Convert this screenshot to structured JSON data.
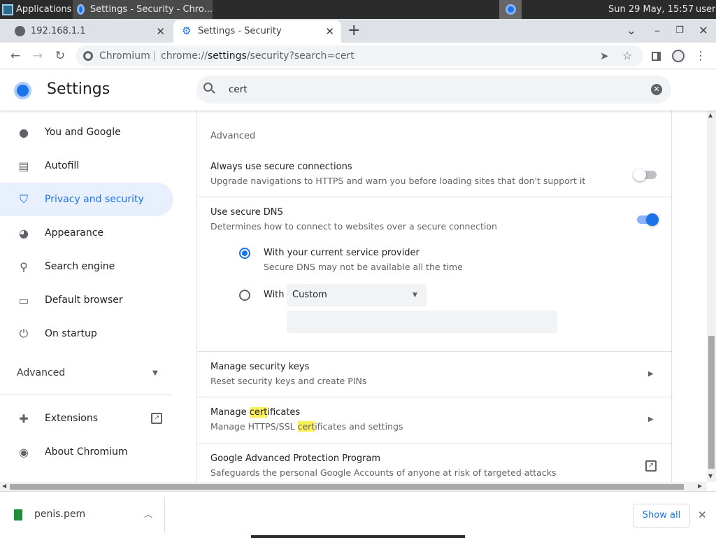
{
  "taskbar": {
    "apps_label": "Applications",
    "window_title": "Settings - Security - Chro...",
    "clock": "Sun 29 May, 15:57",
    "user": "user"
  },
  "tabs": [
    {
      "title": "192.168.1.1",
      "close": "✕"
    },
    {
      "title": "Settings - Security",
      "close": "✕"
    }
  ],
  "new_tab": "+",
  "window_controls": {
    "dropdown": "⌄",
    "minimize": "–",
    "restore": "❐",
    "close": "✕"
  },
  "toolbar": {
    "site_name": "Chromium",
    "url_scheme": "chrome://",
    "url_host": "settings",
    "url_path": "/security?search=cert"
  },
  "settings": {
    "title": "Settings",
    "search_value": "cert"
  },
  "sidebar": {
    "items": [
      {
        "label": "You and Google",
        "icon": "person-icon"
      },
      {
        "label": "Autofill",
        "icon": "clipboard-icon"
      },
      {
        "label": "Privacy and security",
        "icon": "shield-icon"
      },
      {
        "label": "Appearance",
        "icon": "palette-icon"
      },
      {
        "label": "Search engine",
        "icon": "search-icon"
      },
      {
        "label": "Default browser",
        "icon": "browser-icon"
      },
      {
        "label": "On startup",
        "icon": "power-icon"
      }
    ],
    "advanced_label": "Advanced",
    "extensions_label": "Extensions",
    "about_label": "About Chromium"
  },
  "content": {
    "section_heading": "Advanced",
    "always_secure": {
      "title": "Always use secure connections",
      "sub": "Upgrade navigations to HTTPS and warn you before loading sites that don't support it",
      "enabled": false
    },
    "secure_dns": {
      "title": "Use secure DNS",
      "sub": "Determines how to connect to websites over a secure connection",
      "enabled": true,
      "option1_title": "With your current service provider",
      "option1_sub": "Secure DNS may not be available all the time",
      "option2_label": "With",
      "provider_selected": "Custom",
      "custom_input_value": ""
    },
    "security_keys": {
      "title": "Manage security keys",
      "sub": "Reset security keys and create PINs"
    },
    "certificates": {
      "title_pre": "Manage ",
      "title_mark": "cert",
      "title_post": "ificates",
      "sub_pre": "Manage HTTPS/SSL ",
      "sub_mark": "cert",
      "sub_post": "ificates and settings"
    },
    "gapp": {
      "title": "Google Advanced Protection Program",
      "sub": "Safeguards the personal Google Accounts of anyone at risk of targeted attacks"
    }
  },
  "downloads": {
    "file_name": "penis.pem",
    "show_all": "Show all"
  },
  "colors": {
    "accent": "#1a73e8",
    "highlight": "#fcf05a",
    "taskbar": "#2b2b2b"
  }
}
